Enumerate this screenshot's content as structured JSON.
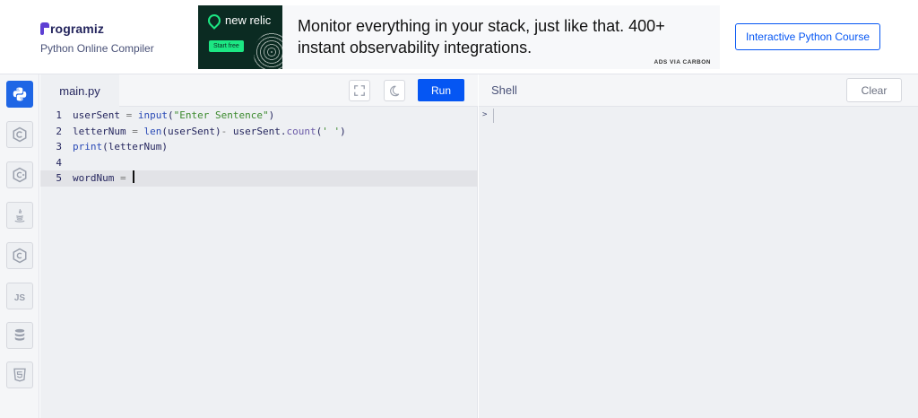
{
  "header": {
    "logo_text": "rogramiz",
    "subtitle": "Python Online Compiler",
    "ad": {
      "brand": "new relic",
      "cta": "Start free",
      "text": "Monitor everything in your stack, just like that. 400+ instant observability integrations.",
      "via": "ADS VIA CARBON"
    },
    "course_button": "Interactive Python Course"
  },
  "sidebar": {
    "items": [
      {
        "name": "python",
        "icon": "python-icon",
        "active": true
      },
      {
        "name": "c",
        "icon": "c-icon"
      },
      {
        "name": "cpp",
        "icon": "cpp-icon"
      },
      {
        "name": "java",
        "icon": "java-icon"
      },
      {
        "name": "csharp",
        "icon": "csharp-icon"
      },
      {
        "name": "javascript",
        "icon": "js-icon",
        "label": "JS"
      },
      {
        "name": "sql",
        "icon": "database-icon"
      },
      {
        "name": "html",
        "icon": "html5-icon"
      }
    ]
  },
  "editor": {
    "file_tab": "main.py",
    "run_label": "Run",
    "lines": [
      {
        "num": "1",
        "tokens": [
          [
            "userSent ",
            ""
          ],
          [
            "=",
            "op"
          ],
          [
            " ",
            ""
          ],
          [
            "input",
            "kw"
          ],
          [
            "(",
            ""
          ],
          [
            "\"Enter Sentence\"",
            "str"
          ],
          [
            ")",
            ""
          ]
        ]
      },
      {
        "num": "2",
        "tokens": [
          [
            "letterNum ",
            ""
          ],
          [
            "=",
            "op"
          ],
          [
            " ",
            ""
          ],
          [
            "len",
            "kw"
          ],
          [
            "(userSent)",
            ""
          ],
          [
            "-",
            "op"
          ],
          [
            " userSent.",
            ""
          ],
          [
            "count",
            "fn"
          ],
          [
            "(",
            ""
          ],
          [
            "' '",
            "str"
          ],
          [
            ")",
            ""
          ]
        ]
      },
      {
        "num": "3",
        "tokens": [
          [
            "print",
            "kw"
          ],
          [
            "(letterNum)",
            ""
          ]
        ]
      },
      {
        "num": "4",
        "tokens": []
      },
      {
        "num": "5",
        "tokens": [
          [
            "wordNum ",
            ""
          ],
          [
            "=",
            "op"
          ],
          [
            " ",
            ""
          ]
        ],
        "active": true
      }
    ]
  },
  "shell": {
    "label": "Shell",
    "clear_label": "Clear",
    "prompt": ">"
  }
}
